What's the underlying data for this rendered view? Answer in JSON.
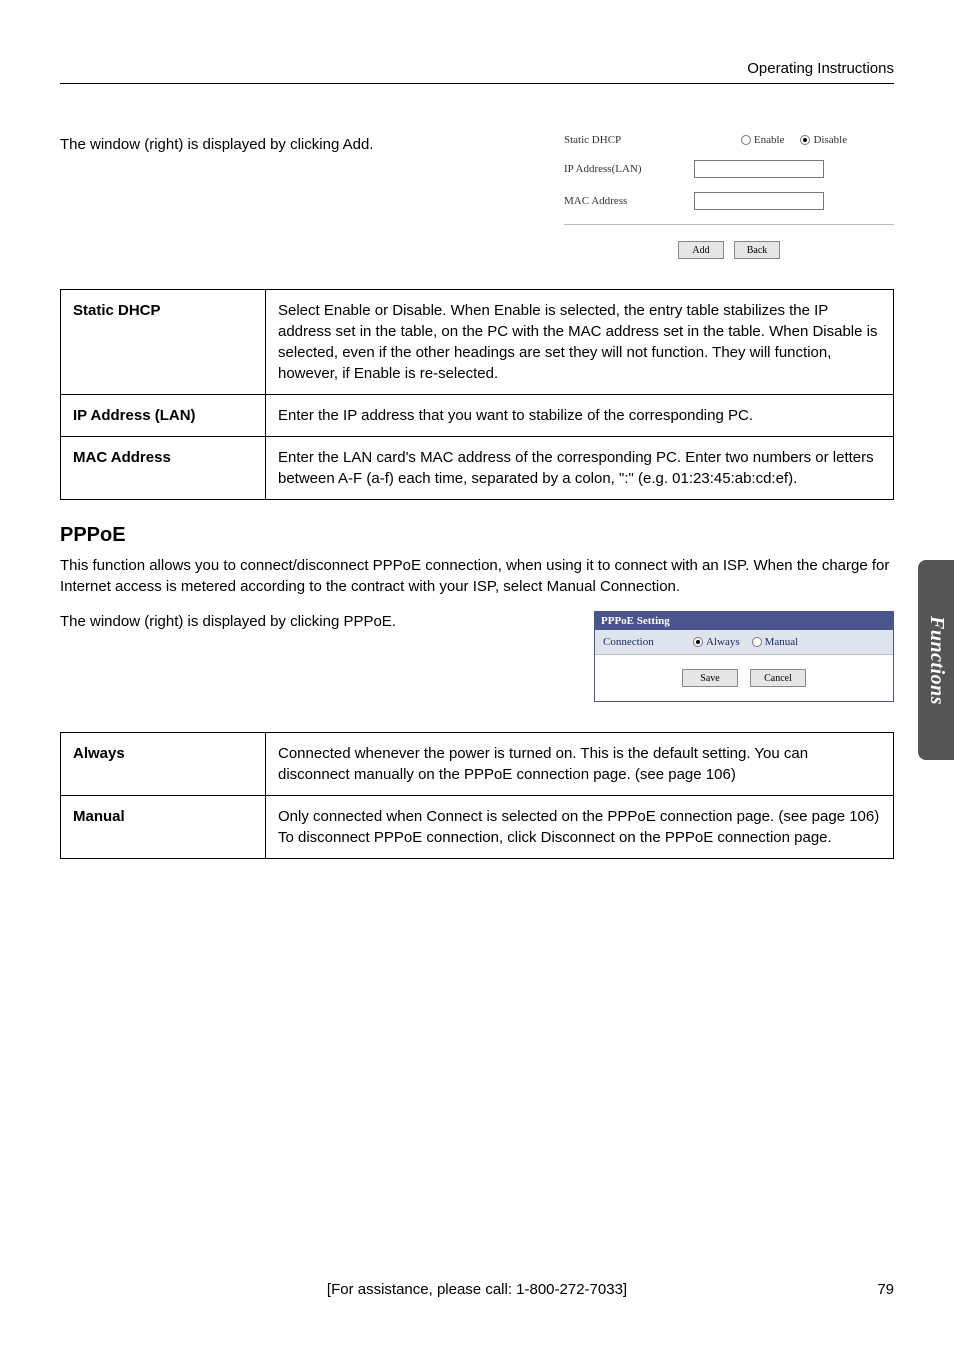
{
  "header": {
    "title": "Operating Instructions"
  },
  "static_dhcp": {
    "intro": "The window (right) is displayed by clicking Add.",
    "form": {
      "static_dhcp_label": "Static DHCP",
      "enable_label": "Enable",
      "disable_label": "Disable",
      "ip_label": "IP Address(LAN)",
      "mac_label": "MAC Address",
      "add_btn": "Add",
      "back_btn": "Back"
    },
    "table": [
      {
        "label": "Static DHCP",
        "desc": "Select Enable or Disable. When Enable is selected, the entry table stabilizes the IP address set in the table, on the PC with the MAC address set in the table. When Disable is selected, even if the other headings are set they will not function. They will function, however, if Enable is re-selected."
      },
      {
        "label": "IP Address (LAN)",
        "desc": "Enter the IP address that you want to stabilize of the corresponding PC."
      },
      {
        "label": "MAC Address",
        "desc": "Enter the LAN card's MAC address of the corresponding PC. Enter two numbers or letters between A-F (a-f) each time, separated by a colon, \":\" (e.g. 01:23:45:ab:cd:ef)."
      }
    ]
  },
  "pppoe": {
    "heading": "PPPoE",
    "body": "This function allows you to connect/disconnect PPPoE connection, when using it to connect with an ISP. When the charge for Internet access is metered according to the contract with your ISP, select Manual Connection.",
    "intro": "The window (right) is displayed by clicking PPPoE.",
    "box": {
      "title": "PPPoE Setting",
      "connection_label": "Connection",
      "always_label": "Always",
      "manual_label": "Manual",
      "save_btn": "Save",
      "cancel_btn": "Cancel"
    },
    "table": [
      {
        "label": "Always",
        "desc": "Connected whenever the power is turned on. This is the default setting. You can disconnect manually on the PPPoE connection page. (see page 106)"
      },
      {
        "label": "Manual",
        "desc": "Only connected when Connect is selected on the PPPoE connection page. (see page 106) To disconnect PPPoE connection, click Disconnect on the PPPoE connection page."
      }
    ]
  },
  "side_tab": {
    "label": "Functions"
  },
  "footer": {
    "assist": "[For assistance, please call: 1-800-272-7033]",
    "page": "79"
  }
}
